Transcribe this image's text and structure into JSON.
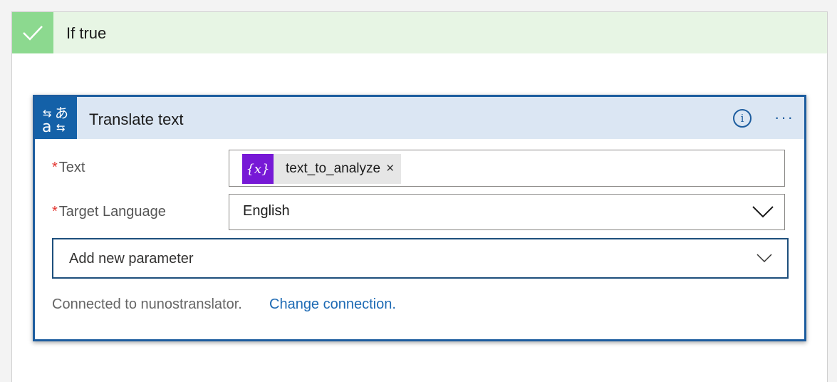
{
  "branch": {
    "title": "If true",
    "header_color": "#e7f5e4",
    "check_color": "#8cd98f"
  },
  "action": {
    "title": "Translate text",
    "icon": "translate-icon",
    "accent": "#1461a8",
    "info_icon": "info-icon",
    "more_icon": "more-options-icon"
  },
  "fields": {
    "text": {
      "label": "Text",
      "required": "*",
      "token": {
        "icon": "variable-icon",
        "icon_glyph": "{x}",
        "value": "text_to_analyze",
        "remove": "×"
      }
    },
    "target_language": {
      "label": "Target Language",
      "required": "*",
      "value": "English"
    }
  },
  "add_parameter": {
    "label": "Add new parameter"
  },
  "connection": {
    "status": "Connected to nunostranslator.",
    "change_link": "Change connection."
  }
}
